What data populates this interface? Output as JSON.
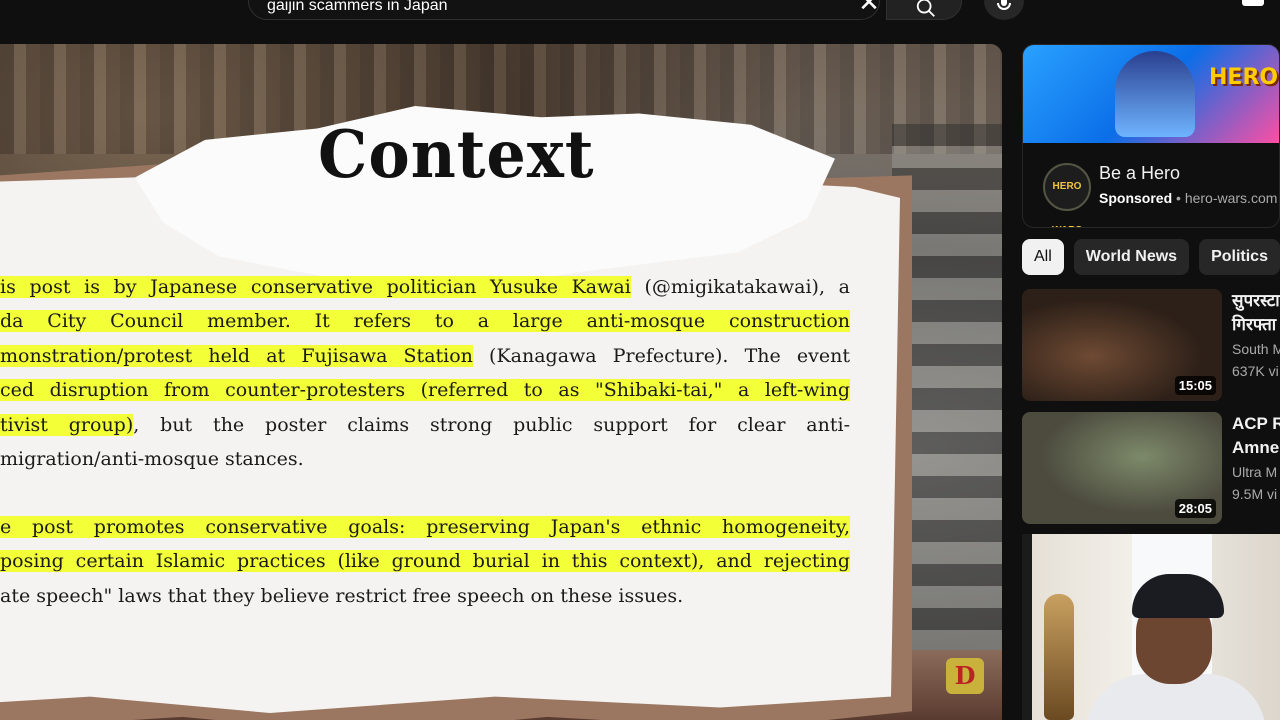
{
  "search": {
    "query": "gaijin scammers in Japan"
  },
  "player": {
    "slide_title": "Context",
    "paragraph1": [
      {
        "hl": "is post is by Japanese conservative politician Yusuke Kawai",
        "plain": " (@migikatakawai), a"
      },
      {
        "hl": "da City Council member. It refers to a large anti-mosque construction",
        "plain": ""
      },
      {
        "hl": "monstration/protest held at Fujisawa Station",
        "plain": " (Kanagawa Prefecture). The event"
      },
      {
        "hl": "ced disruption from counter-protesters (referred to as \"Shibaki-tai,\" a left-wing",
        "plain": ""
      },
      {
        "hl": "tivist group)",
        "plain": ", but the poster claims strong public support for clear anti-"
      },
      {
        "hl": "",
        "plain": "migration/anti-mosque stances."
      }
    ],
    "paragraph2": [
      {
        "hl": "e post promotes conservative goals: preserving Japan's ethnic homogeneity,",
        "plain": ""
      },
      {
        "hl": "posing certain Islamic practices (like ground burial in this context), and rejecting",
        "plain": ""
      },
      {
        "hl": "",
        "plain": "ate speech\" laws that they believe restrict free speech on these issues."
      }
    ],
    "watermark": "D"
  },
  "ad": {
    "banner_text": "HERO WA",
    "logo_text": "HERO WARS",
    "title": "Be a Hero",
    "sponsored": "Sponsored",
    "domain": "hero-wars.com"
  },
  "chips": [
    "All",
    "World News",
    "Politics"
  ],
  "recommendations": [
    {
      "title_line1": "सुपरस्टा",
      "title_line2": "गिरफ्ता",
      "channel": "South M",
      "meta": "637K vi",
      "duration": "15:05"
    },
    {
      "title_line1": "ACP R",
      "title_line2": "Amne",
      "channel": "Ultra M",
      "meta": "9.5M vi",
      "duration": "28:05"
    }
  ]
}
